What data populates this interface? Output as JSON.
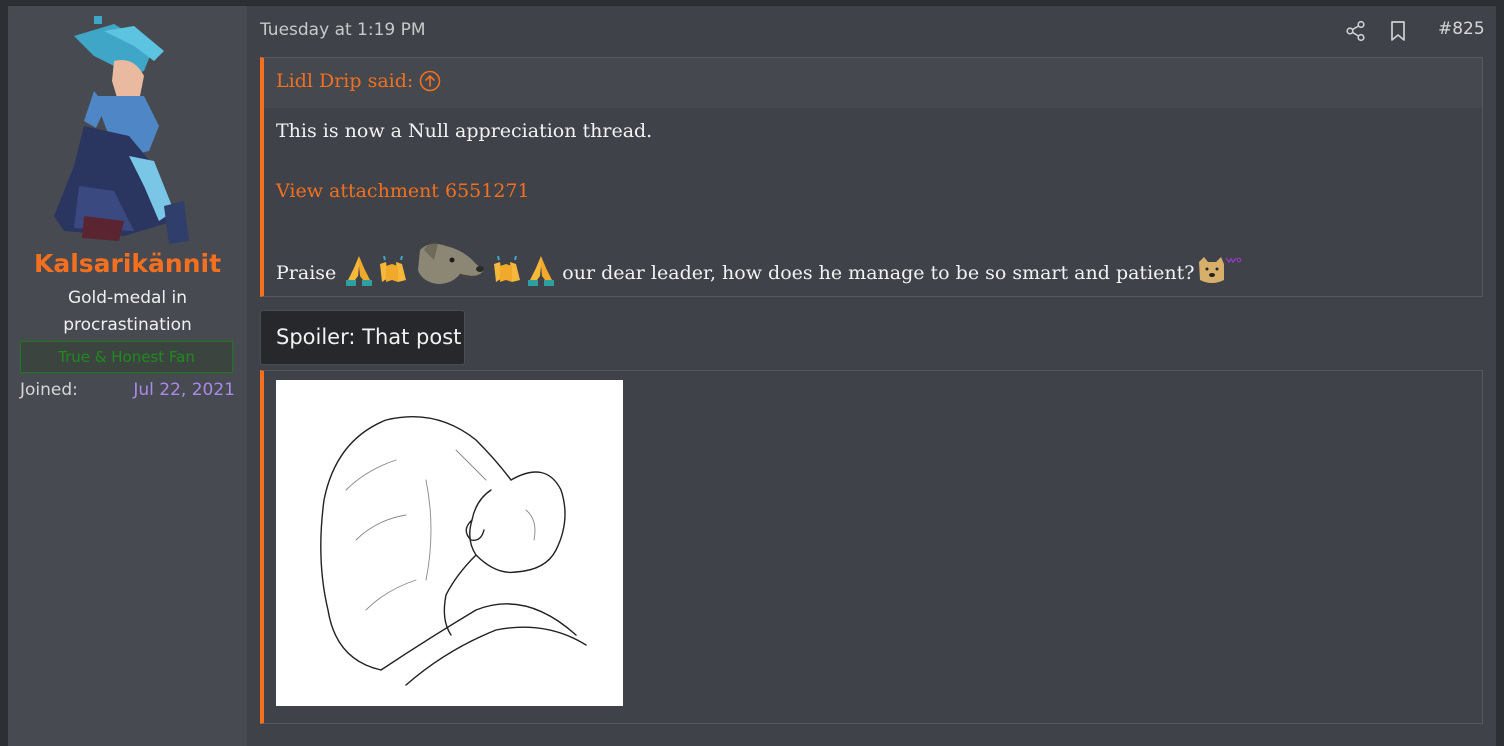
{
  "post": {
    "date": "Tuesday at 1:19 PM",
    "number": "#825",
    "share_icon": "share-icon",
    "bookmark_icon": "bookmark-icon"
  },
  "user": {
    "name": "Kalsarikännit",
    "title": "Gold-medal in procrastination",
    "banner": "True & Honest Fan",
    "joined_label": "Joined:",
    "joined_value": "Jul 22, 2021",
    "accent": "#f4701e"
  },
  "quote": {
    "author": "Lidl Drip said:",
    "line1": "This is now a Null appreciation thread.",
    "attachment_link": "View attachment 6551271",
    "line3_prefix": "Praise",
    "line3_suffix": "our dear leader, how does he manage to be so smart and patient?"
  },
  "spoiler": {
    "label": "Spoiler: That post"
  }
}
